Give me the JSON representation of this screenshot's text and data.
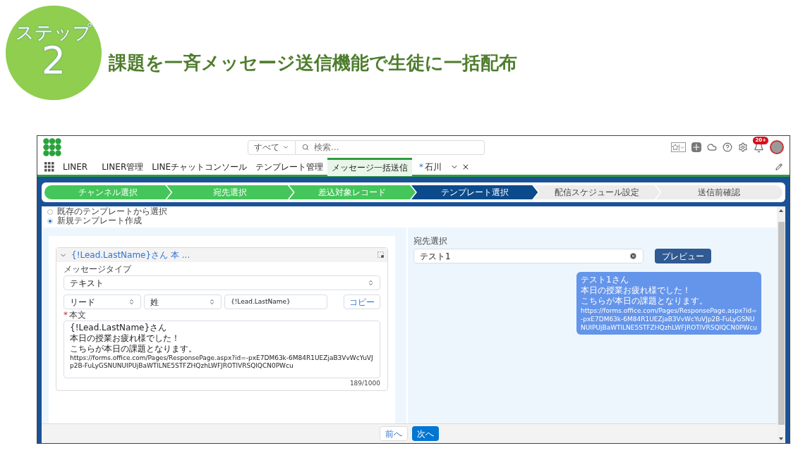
{
  "header": {
    "step_label": "ステップ",
    "step_number": "2",
    "title": "課題を一斉メッセージ送信機能で生徒に一括配布"
  },
  "app": {
    "search": {
      "scope": "すべて",
      "placeholder": "検索..."
    },
    "notification_badge": "20+",
    "app_name": "LINER",
    "nav_tabs": [
      {
        "label": "LINER管理",
        "selected": false
      },
      {
        "label": "LINEチャットコンソール",
        "selected": false
      },
      {
        "label": "テンプレート管理",
        "selected": false
      },
      {
        "label": "メッセージ一括送信",
        "selected": true
      }
    ],
    "workspace_tab": {
      "marker": "*",
      "label": "石川"
    },
    "steps": [
      {
        "label": "チャンネル選択",
        "kind": "done"
      },
      {
        "label": "宛先選択",
        "kind": "done"
      },
      {
        "label": "差込対象レコード",
        "kind": "done"
      },
      {
        "label": "テンプレート選択",
        "kind": "current"
      },
      {
        "label": "配信スケジュール設定",
        "kind": "todo"
      },
      {
        "label": "送信前確認",
        "kind": "todo"
      }
    ],
    "template_options": [
      {
        "label": "既存のテンプレートから選択",
        "selected": false
      },
      {
        "label": "新規テンプレート作成",
        "selected": true
      }
    ],
    "message_card": {
      "title": "{!Lead.LastName}さん 本 ...",
      "expanded": true,
      "message_type_label": "メッセージタイプ",
      "message_type": "テキスト",
      "object": "リード",
      "field": "姓",
      "merge_field": "{!Lead.LastName}",
      "copy_button": "コピー",
      "body_label": "本文",
      "required": true,
      "body_lines": [
        "{!Lead.LastName}さん",
        "本日の授業お疲れ様でした！",
        "こちらが本日の課題となります。",
        "https://forms.office.com/Pages/ResponsePage.aspx?id=-pxE7DM63k-6M84R1UEZjaB3VvWcYuVJp2B-FuLyGSNUNUIPUjBaWTlLNE5STFZHQzhLWFJROTlVRSQlQCN0PWcu"
      ],
      "char_count": "189/1000"
    },
    "preview": {
      "recipient_label": "宛先選択",
      "recipient": "テスト1",
      "preview_button": "プレビュー",
      "bubble_lines": [
        "テスト1さん",
        "本日の授業お疲れ様でした！",
        "こちらが本日の課題となります。",
        "https://forms.office.com/Pages/ResponsePage.aspx?id=-pxE7DM63k-6M84R1UEZjaB3VvWcYuVJp2B-FuLyGSNUNUIPUjBaWTlLNE5STFZHQzhLWFJROTlVRSQlQCN0PWcu"
      ]
    },
    "footer": {
      "back": "前へ",
      "next": "次へ"
    }
  }
}
